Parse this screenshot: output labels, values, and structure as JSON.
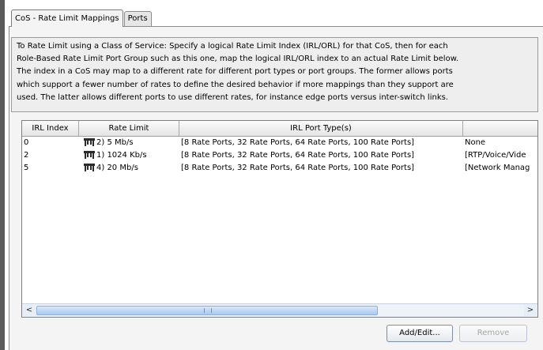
{
  "tabs": [
    {
      "label": "CoS - Rate Limit Mappings",
      "active": true
    },
    {
      "label": "Ports",
      "active": false
    }
  ],
  "description": "To Rate Limit using a Class of Service: Specify a logical Rate Limit Index (IRL/ORL) for that CoS, then for each\nRole-Based Rate Limit Port Group such as this one, map the logical IRL/ORL index to an actual Rate Limit below.\nThe index in a CoS may map to a different rate for different port types or port groups.  The former allows ports\nwhich support a fewer number of rates to define the desired behavior if more mappings than they support are\nused. The latter allows different ports to use different rates, for instance edge ports versus inter-switch links.",
  "table": {
    "columns": [
      "IRL Index",
      "Rate Limit",
      "IRL Port Type(s)",
      ""
    ],
    "rows": [
      {
        "index": "0",
        "rate_limit": "2) 5 Mb/s",
        "port_types": "[8 Rate Ports, 32 Rate Ports, 64 Rate Ports, 100 Rate Ports]",
        "extra": "None"
      },
      {
        "index": "2",
        "rate_limit": "1) 1024 Kb/s",
        "port_types": "[8 Rate Ports, 32 Rate Ports, 64 Rate Ports, 100 Rate Ports]",
        "extra": "[RTP/Voice/Vide"
      },
      {
        "index": "5",
        "rate_limit": "4) 20 Mb/s",
        "port_types": "[8 Rate Ports, 32 Rate Ports, 64 Rate Ports, 100 Rate Ports]",
        "extra": "[Network Manag"
      }
    ]
  },
  "scrollbar": {
    "left_arrow": "<",
    "right_arrow": ">"
  },
  "buttons": {
    "add_edit": "Add/Edit...",
    "remove": "Remove"
  },
  "icons": {
    "rate_limit": "rate-limit-icon"
  }
}
